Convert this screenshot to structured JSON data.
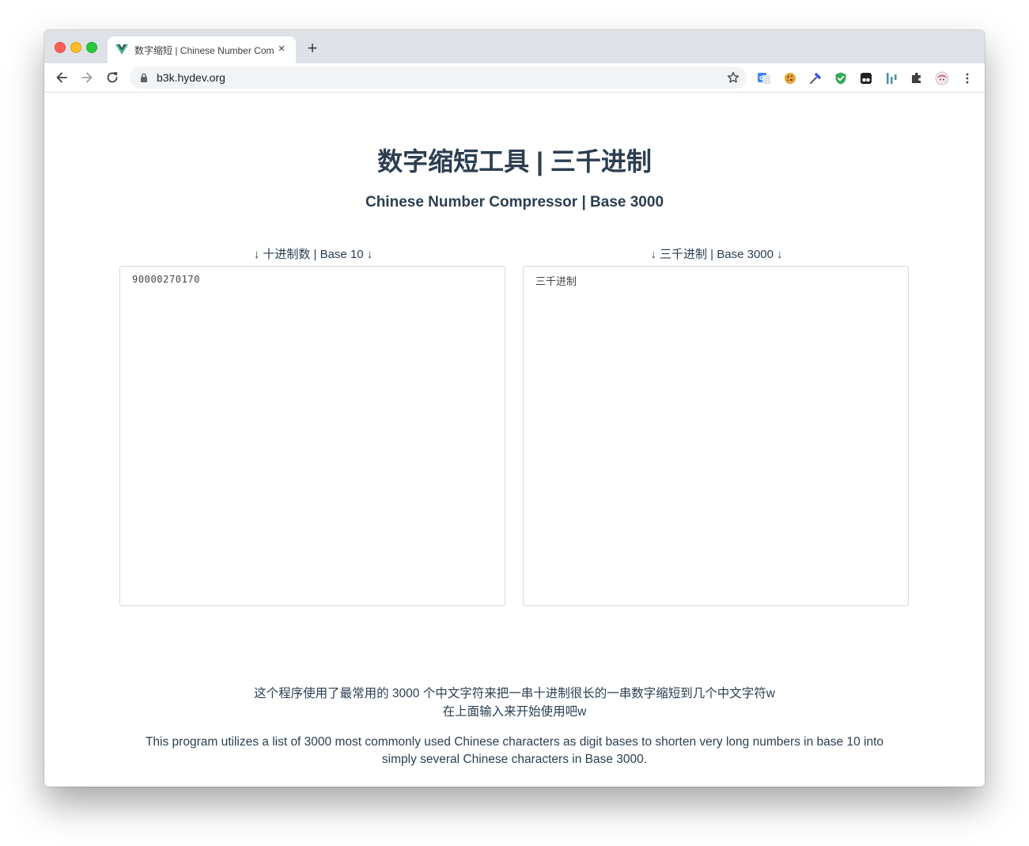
{
  "browser": {
    "tab_title": "数字缩短 | Chinese Number Compressor",
    "close_glyph": "×",
    "new_tab_glyph": "+",
    "url": "b3k.hydev.org",
    "extensions": [
      "google-translate-icon",
      "cookie-icon",
      "eyedropper-icon",
      "shield-check-icon",
      "tampermonkey-icon",
      "bar-chart-icon",
      "puzzle-icon",
      "profile-avatar-icon",
      "more-vert-icon"
    ]
  },
  "page": {
    "title": "数字缩短工具 | 三千进制",
    "subtitle": "Chinese Number Compressor | Base 3000",
    "left_label": "↓ 十进制数 | Base 10 ↓",
    "right_label": "↓ 三千进制 | Base 3000 ↓",
    "decimal_value": "90000270170",
    "base3000_value": "三千进制",
    "desc_cn_line1": "这个程序使用了最常用的 3000 个中文字符来把一串十进制很长的一串数字缩短到几个中文字符w",
    "desc_cn_line2": "在上面输入来开始使用吧w",
    "desc_en_line1": "This program utilizes a list of 3000 most commonly used Chinese characters as digit bases to shorten very long numbers in base 10 into",
    "desc_en_line2": "simply several Chinese characters in Base 3000."
  },
  "colors": {
    "text": "#2c3e50",
    "tabstrip": "#dee1e6",
    "omnibox": "#f1f3f4",
    "vue_green": "#42b883",
    "vue_dark": "#35495e"
  }
}
